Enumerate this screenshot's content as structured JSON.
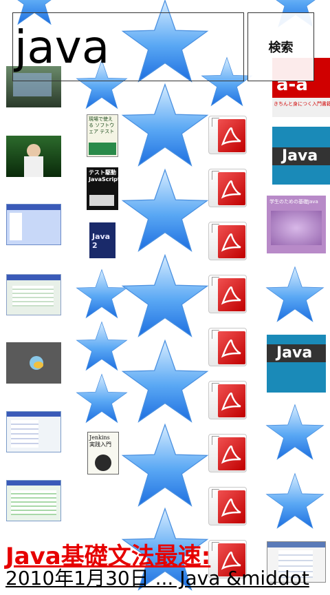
{
  "search": {
    "query": "java",
    "button_label": "検索"
  },
  "book_covers": {
    "book1_title": "現場で使える ソフトウェア テスト",
    "book2_title": "テスト駆動 JavaScript",
    "book3_title": "Java 2",
    "book4_title": "Jenkins 実践入門",
    "big1_title": "a-a",
    "big1_sub": "きちんと身につく入門書籍",
    "big2_title": "Java",
    "big3_title": "学生のための基礎Java",
    "big4_title": "Java"
  },
  "result": {
    "title": "Java基礎文法最速:",
    "snippet": "2010年1月30日 ... Java &middot"
  },
  "colors": {
    "star_light": "#bfe0ff",
    "star_dark": "#1e6fe0",
    "pdf_red": "#d00000",
    "result_title": "#e60000"
  }
}
